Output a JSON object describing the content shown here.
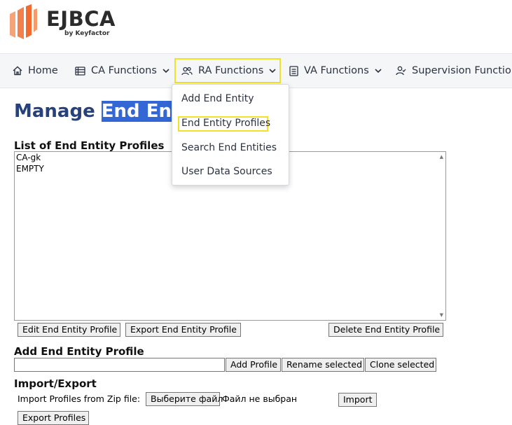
{
  "header": {
    "logo_text": "EJBCA",
    "logo_subtext": "by Keyfactor",
    "brand_color": "#f26a2e"
  },
  "nav": {
    "items": [
      {
        "label": "Home",
        "icon": "home-icon"
      },
      {
        "label": "CA Functions",
        "icon": "list-icon"
      },
      {
        "label": "RA Functions",
        "icon": "users-icon"
      },
      {
        "label": "VA Functions",
        "icon": "document-icon"
      },
      {
        "label": "Supervision Functions",
        "icon": "user-check-icon"
      }
    ]
  },
  "dropdown": {
    "items": [
      "Add End Entity",
      "End Entity Profiles",
      "Search End Entities",
      "User Data Sources"
    ],
    "highlight_color": "#f0e228"
  },
  "page": {
    "title_prefix": "Manage ",
    "title_selected": "End Enti",
    "title_color": "#27427a"
  },
  "list_section": {
    "label": "List of End Entity Profiles",
    "options": [
      "CA-gk",
      "EMPTY"
    ],
    "buttons": {
      "edit": "Edit End Entity Profile",
      "export": "Export End Entity Profile",
      "delete": "Delete End Entity Profile"
    }
  },
  "add_section": {
    "label": "Add End Entity Profile",
    "input_value": "",
    "buttons": {
      "add": "Add Profile",
      "rename": "Rename selected",
      "clone": "Clone selected"
    }
  },
  "import_export": {
    "label": "Import/Export",
    "import_text": "Import Profiles from Zip file:",
    "choose_file_label": "Выберите файл",
    "file_status": "Файл не выбран",
    "import_button": "Import",
    "export_button": "Export Profiles"
  }
}
